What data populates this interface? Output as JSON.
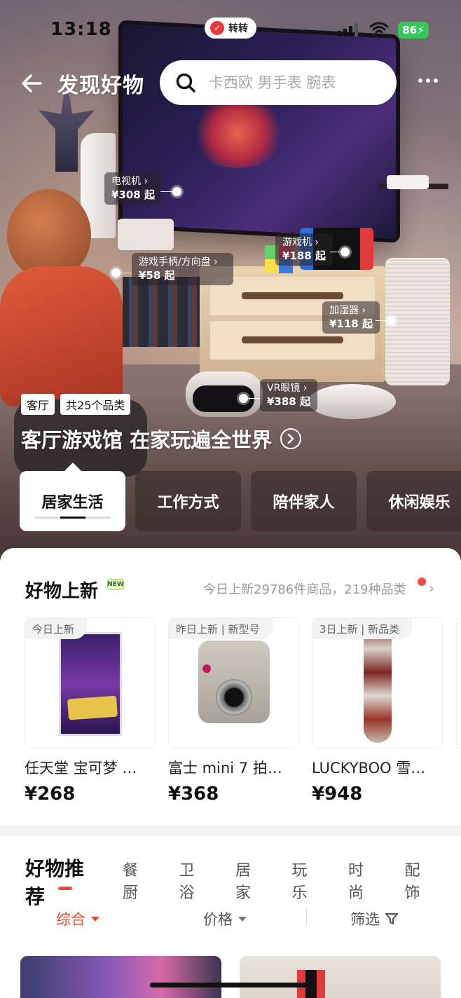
{
  "status": {
    "time": "13:18",
    "app_pill": "转转",
    "battery": "86"
  },
  "header": {
    "title": "发现好物",
    "search_placeholder": "卡西欧 男手表 腕表"
  },
  "hotspots": [
    {
      "name": "电视机 ›",
      "price": "¥308 起"
    },
    {
      "name": "游戏手柄/方向盘 ›",
      "price": "¥58 起"
    },
    {
      "name": "游戏机 ›",
      "price": "¥188 起"
    },
    {
      "name": "加湿器 ›",
      "price": "¥118 起"
    },
    {
      "name": "VR眼镜 ›",
      "price": "¥388 起"
    }
  ],
  "scene": {
    "tag_room": "客厅",
    "tag_count": "共25个品类",
    "title": "客厅游戏馆 在家玩遍全世界"
  },
  "categories": [
    {
      "label": "居家生活",
      "active": true
    },
    {
      "label": "工作方式",
      "active": false
    },
    {
      "label": "陪伴家人",
      "active": false
    },
    {
      "label": "休闲娱乐",
      "active": false
    }
  ],
  "new_arrivals": {
    "title": "好物上新",
    "badge": "NEW",
    "summary": "今日上新29786件商品，219种品类",
    "items": [
      {
        "tag": "今日上新",
        "name": "任天堂 宝可梦 …",
        "price": "¥268"
      },
      {
        "tag": "昨日上新 | 新型号",
        "name": "富士 mini 7 拍…",
        "price": "¥368"
      },
      {
        "tag": "3日上新 | 新品类",
        "name": "LUCKYBOO 雪…",
        "price": "¥948"
      }
    ]
  },
  "recommend": {
    "title": "好物推荐",
    "tabs": [
      "餐厨",
      "卫浴",
      "居家",
      "玩乐",
      "时尚",
      "配饰"
    ],
    "sort": {
      "comprehensive": "综合",
      "price": "价格",
      "filter": "筛选"
    }
  },
  "colors": {
    "accent": "#e84a3a",
    "battery": "#35c759"
  }
}
